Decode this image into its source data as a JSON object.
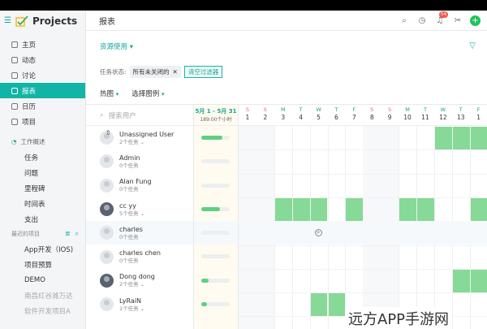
{
  "app": {
    "name": "Projects"
  },
  "sidebar": {
    "items": [
      {
        "label": "主页",
        "icon": "home-icon"
      },
      {
        "label": "动态",
        "icon": "activity-icon"
      },
      {
        "label": "讨论",
        "icon": "chat-icon"
      },
      {
        "label": "报表",
        "icon": "report-icon",
        "active": true
      },
      {
        "label": "日历",
        "icon": "calendar-icon"
      },
      {
        "label": "项目",
        "icon": "project-icon"
      }
    ],
    "overview_label": "工作概述",
    "overview_items": [
      "任务",
      "问题",
      "里程碑",
      "时间表",
      "支出"
    ],
    "recent_label": "最近的项目",
    "recent_items": [
      "App开发（IOS)",
      "项目预算",
      "DEMO",
      "南昌红谷滩万达",
      "软件开发项目A"
    ]
  },
  "header": {
    "title": "报表",
    "badge": "54"
  },
  "report_select": "资源使用",
  "filter": {
    "label": "任务状态:",
    "chip": "所有未关闭的",
    "clear": "清空过滤器"
  },
  "view": {
    "heatmap": "热图",
    "legend": "选择图例"
  },
  "grid": {
    "search_placeholder": "搜索用户",
    "week_range": "5月 1 - 5月 31",
    "week_hours": "189:00个小时",
    "days": [
      {
        "l": "S",
        "n": "1",
        "weekend": true
      },
      {
        "l": "S",
        "n": "2",
        "weekend": true
      },
      {
        "l": "M",
        "n": "3"
      },
      {
        "l": "T",
        "n": "4"
      },
      {
        "l": "W",
        "n": "5"
      },
      {
        "l": "T",
        "n": "6"
      },
      {
        "l": "F",
        "n": "7"
      },
      {
        "l": "S",
        "n": "8",
        "weekend": true
      },
      {
        "l": "S",
        "n": "9",
        "weekend": true
      },
      {
        "l": "M",
        "n": "10"
      },
      {
        "l": "T",
        "n": "11"
      },
      {
        "l": "W",
        "n": "12"
      },
      {
        "l": "T",
        "n": "13"
      },
      {
        "l": "F",
        "n": "1"
      }
    ],
    "users": [
      {
        "name": "Unassigned User",
        "tasks": "2个任务",
        "expand": true,
        "load": 0.75,
        "busy": [
          11,
          12,
          13
        ]
      },
      {
        "name": "Admin",
        "tasks": "0个任务",
        "expand": false,
        "load": 0,
        "busy": []
      },
      {
        "name": "Alan Fung",
        "tasks": "0个任务",
        "expand": false,
        "load": 0,
        "busy": []
      },
      {
        "name": "cc yy",
        "tasks": "5个任务",
        "expand": true,
        "load": 0.65,
        "busy": [
          2,
          3,
          4,
          6,
          9,
          10,
          13
        ]
      },
      {
        "name": "charles",
        "tasks": "0个任务",
        "expand": false,
        "load": 0,
        "busy": [],
        "highlight": true
      },
      {
        "name": "charles chen",
        "tasks": "0个任务",
        "expand": false,
        "load": 0,
        "busy": []
      },
      {
        "name": "Dong dong",
        "tasks": "2个任务",
        "expand": true,
        "load": 0.25,
        "busy": [
          12,
          13
        ]
      },
      {
        "name": "LyRaiN",
        "tasks": "1个任务",
        "expand": true,
        "load": 0.2,
        "busy": [
          4,
          5
        ]
      }
    ]
  },
  "watermark": "远方APP手游网"
}
